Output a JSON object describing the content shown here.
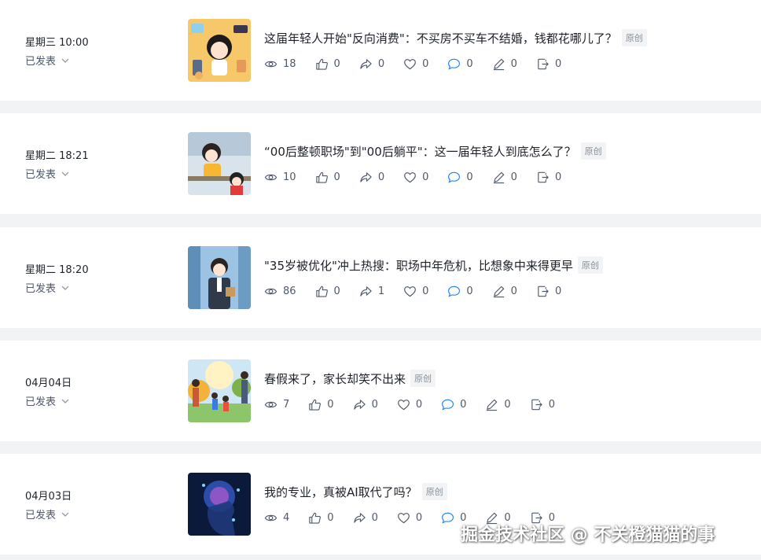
{
  "articles": [
    {
      "date": "星期三 10:00",
      "status": "已发表",
      "title": "这届年轻人开始\"反向消费\"：不买房不买车不结婚，钱都花哪儿了？",
      "badge": "原创",
      "stats": {
        "views": "18",
        "likes": "0",
        "shares": "0",
        "favorites": "0",
        "comments": "0",
        "edits": "0",
        "exports": "0"
      }
    },
    {
      "date": "星期二 18:21",
      "status": "已发表",
      "title": "“00后整顿职场\"到\"00后躺平\"：这一届年轻人到底怎么了？",
      "badge": "原创",
      "stats": {
        "views": "10",
        "likes": "0",
        "shares": "0",
        "favorites": "0",
        "comments": "0",
        "edits": "0",
        "exports": "0"
      }
    },
    {
      "date": "星期二 18:20",
      "status": "已发表",
      "title": "\"35岁被优化\"冲上热搜：职场中年危机，比想象中来得更早",
      "badge": "原创",
      "stats": {
        "views": "86",
        "likes": "0",
        "shares": "1",
        "favorites": "0",
        "comments": "0",
        "edits": "0",
        "exports": "0"
      }
    },
    {
      "date": "04月04日",
      "status": "已发表",
      "title": "春假来了，家长却笑不出来",
      "badge": "原创",
      "stats": {
        "views": "7",
        "likes": "0",
        "shares": "0",
        "favorites": "0",
        "comments": "0",
        "edits": "0",
        "exports": "0"
      }
    },
    {
      "date": "04月03日",
      "status": "已发表",
      "title": "我的专业，真被AI取代了吗？",
      "badge": "原创",
      "stats": {
        "views": "4",
        "likes": "0",
        "shares": "0",
        "favorites": "0",
        "comments": "0",
        "edits": "0",
        "exports": "0"
      }
    }
  ],
  "icons": {
    "views": "eye-icon",
    "likes": "thumbs-up-icon",
    "shares": "share-arrow-icon",
    "favorites": "heart-icon",
    "comments": "comment-icon",
    "edits": "pen-icon",
    "exports": "export-icon",
    "status": "chevron-down-icon"
  },
  "colors": {
    "page_bg": "#f2f3f5",
    "card_bg": "#ffffff",
    "text": "#1d2129",
    "muted": "#4e5969",
    "badge_text": "#86909c"
  },
  "watermark": "掘金技术社区 @ 不关橙猫猫的事"
}
